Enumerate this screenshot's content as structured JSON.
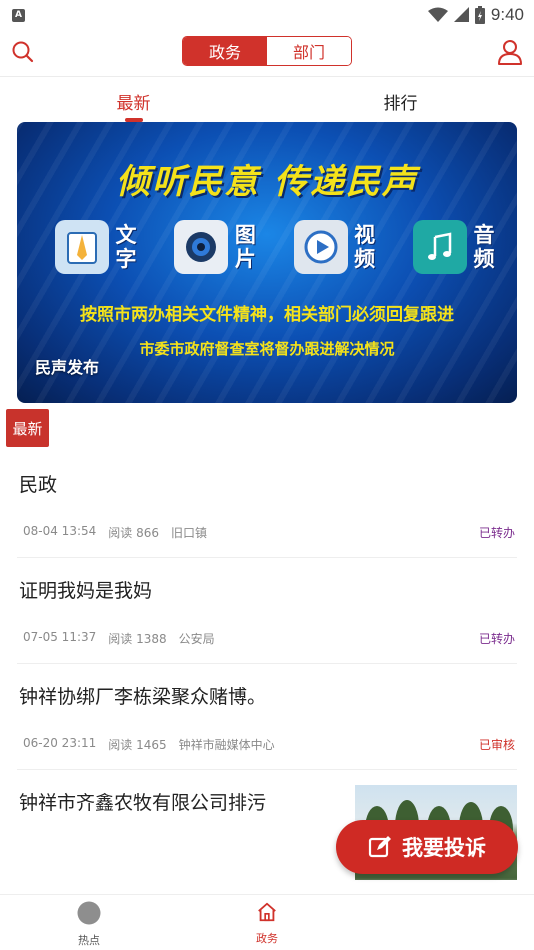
{
  "status_bar": {
    "time": "9:40",
    "left_icon": "A",
    "icons": [
      "wifi-icon",
      "signal-icon",
      "battery-icon"
    ]
  },
  "header": {
    "search_icon": "search-icon",
    "user_icon": "user-icon",
    "segments": [
      {
        "label": "政务",
        "active": true
      },
      {
        "label": "部门",
        "active": false
      }
    ]
  },
  "tabs": [
    {
      "label": "最新",
      "active": true
    },
    {
      "label": "排行",
      "active": false
    }
  ],
  "banner": {
    "headline": "倾听民意  传递民声",
    "icons": [
      {
        "name": "text-icon",
        "label": "文字"
      },
      {
        "name": "image-icon",
        "label": "图片"
      },
      {
        "name": "video-icon",
        "label": "视频"
      },
      {
        "name": "audio-icon",
        "label": "音频"
      }
    ],
    "line1": "按照市两办相关文件精神，相关部门必须回复跟进",
    "line2": "市委市政府督查室将督办跟进解决情况",
    "caption": "民声发布"
  },
  "latest_tag": "最新",
  "news": [
    {
      "title": "民政",
      "time": "08-04 13:54",
      "reads": "阅读 866",
      "source": "旧口镇",
      "status": "已转办",
      "status_color": "#7b2d8e"
    },
    {
      "title": "证明我妈是我妈",
      "time": "07-05 11:37",
      "reads": "阅读 1388",
      "source": "公安局",
      "status": "已转办",
      "status_color": "#7b2d8e"
    },
    {
      "title": "钟祥协绑厂李栋梁聚众赌博。",
      "time": "06-20 23:11",
      "reads": "阅读 1465",
      "source": "钟祥市融媒体中心",
      "status": "已审核",
      "status_color": "#d0322b"
    },
    {
      "title": "钟祥市齐鑫农牧有限公司排污"
    }
  ],
  "complain_button": {
    "label": "我要投诉",
    "icon": "edit-icon"
  },
  "bottom_nav": [
    {
      "label": "热点",
      "icon": "hot-icon",
      "active": false
    },
    {
      "label": "政务",
      "icon": "home-icon",
      "active": true
    }
  ],
  "colors": {
    "accent": "#d0322b",
    "forwarded": "#7b2d8e",
    "meta": "#8a8a8a"
  }
}
